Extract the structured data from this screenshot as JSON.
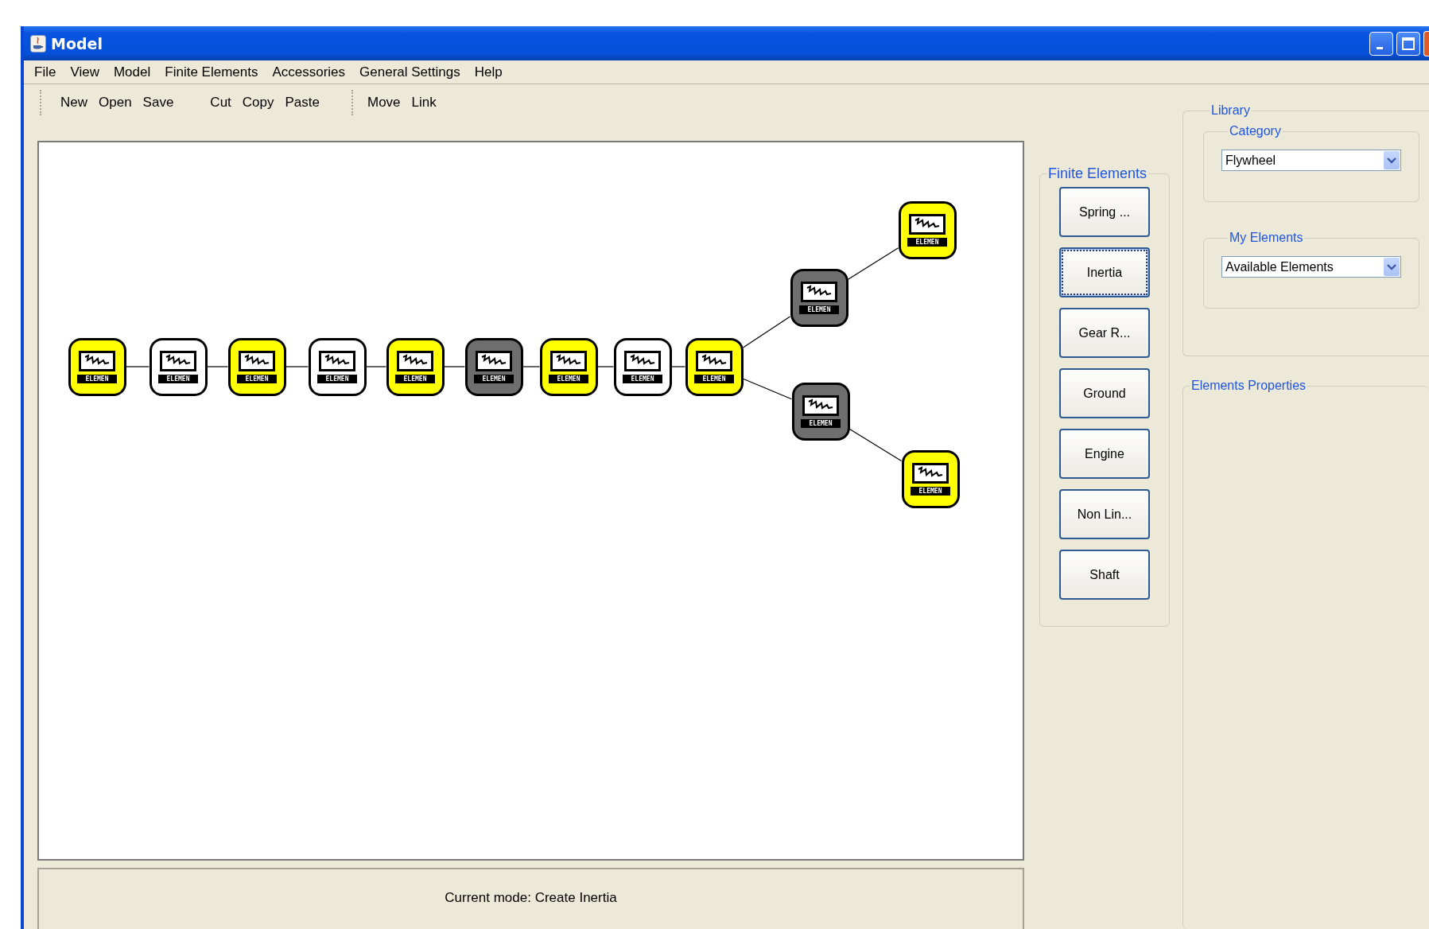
{
  "window": {
    "title": "Model"
  },
  "menu": [
    "File",
    "View",
    "Model",
    "Finite Elements",
    "Accessories",
    "General Settings",
    "Help"
  ],
  "toolbar": [
    {
      "items": [
        "New",
        "Open",
        "Save"
      ],
      "separated": false
    },
    {
      "items": [
        "Cut",
        "Copy",
        "Paste"
      ],
      "separated": false
    },
    {
      "items": [
        "Move",
        "Link"
      ],
      "separated": true
    }
  ],
  "canvas": {
    "nodes": [
      {
        "label": "ELEMEN",
        "color": "#ffff00"
      },
      {
        "label": "ELEMEN",
        "color": "#ffffff"
      },
      {
        "label": "ELEMEN",
        "color": "#ffff00"
      },
      {
        "label": "ELEMEN",
        "color": "#ffffff"
      },
      {
        "label": "ELEMEN",
        "color": "#ffff00"
      },
      {
        "label": "ELEMEN",
        "color": "#6e6e6e"
      },
      {
        "label": "ELEMEN",
        "color": "#ffff00"
      },
      {
        "label": "ELEMEN",
        "color": "#ffffff"
      },
      {
        "label": "ELEMEN",
        "color": "#ffff00"
      },
      {
        "label": "ELEMEN",
        "color": "#6e6e6e"
      },
      {
        "label": "ELEMEN",
        "color": "#6e6e6e"
      },
      {
        "label": "ELEMEN",
        "color": "#ffff00"
      },
      {
        "label": "ELEMEN",
        "color": "#ffff00"
      }
    ]
  },
  "status_bar": {
    "text": "Current mode: Create Inertia"
  },
  "finite_elements": {
    "title": "Finite Elements",
    "buttons": [
      {
        "label": "Spring ...",
        "selected": false
      },
      {
        "label": "Inertia",
        "selected": true
      },
      {
        "label": "Gear R...",
        "selected": false
      },
      {
        "label": "Ground",
        "selected": false
      },
      {
        "label": "Engine",
        "selected": false
      },
      {
        "label": "Non Lin...",
        "selected": false
      },
      {
        "label": "Shaft",
        "selected": false
      }
    ]
  },
  "library": {
    "title": "Library",
    "category": {
      "title": "Category",
      "value": "Flywheel"
    },
    "my_elements": {
      "title": "My Elements",
      "value": "Available Elements"
    }
  },
  "elements_properties": {
    "title": "Elements Properties"
  }
}
